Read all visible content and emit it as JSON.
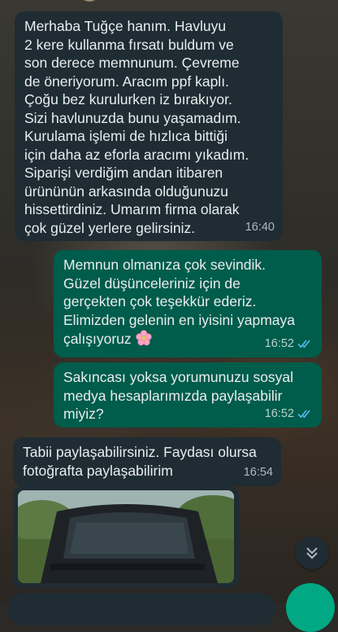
{
  "messages": [
    {
      "direction": "in",
      "text": "Merhaba Tuğçe hanım. Havluyu\n2 kere kullanma fırsatı buldum ve\nson derece memnunum. Çevreme\nde öneriyorum. Aracım ppf kaplı.\nÇoğu bez kurulurken iz bırakıyor.\nSizi havlunuzda bunu yaşamadım.\nKurulama işlemi de hızlıca bittiği\niçin daha az eforla aracımı yıkadım.\nSiparişi verdiğim andan itibaren\nürününün arkasında olduğunuzu\nhissettirdiniz. Umarım firma olarak\nçok güzel yerlere gelirsiniz.",
      "time": "16:40"
    },
    {
      "direction": "out",
      "text": "Memnun olmanıza çok sevindik.\nGüzel düşünceleriniz için de\ngerçekten çok teşekkür ederiz.\nElimizden gelenin en iyisini yapmaya\nçalışıyoruz",
      "time": "16:52",
      "status": "read"
    },
    {
      "direction": "out",
      "text": "Sakıncası yoksa yorumunuzu sosyal\nmedya hesaplarımızda paylaşabilir\nmiyiz?",
      "time": "16:52",
      "status": "read"
    },
    {
      "direction": "in",
      "text": "Tabii paylaşabilirsiniz. Faydası olursa\nfotoğrafta paylaşabilirim",
      "time": "16:54"
    }
  ],
  "media": {
    "type": "photo",
    "subject": "car-rear-window"
  },
  "icons": {
    "read_ticks": "double-check-icon",
    "emoji": "cherry-blossom-icon",
    "scroll": "double-chevron-down-icon"
  },
  "colors": {
    "incoming_bubble": "#1f2c33",
    "outgoing_bubble": "#005c4b",
    "read_tick": "#53bdeb",
    "accent": "#00a884"
  }
}
